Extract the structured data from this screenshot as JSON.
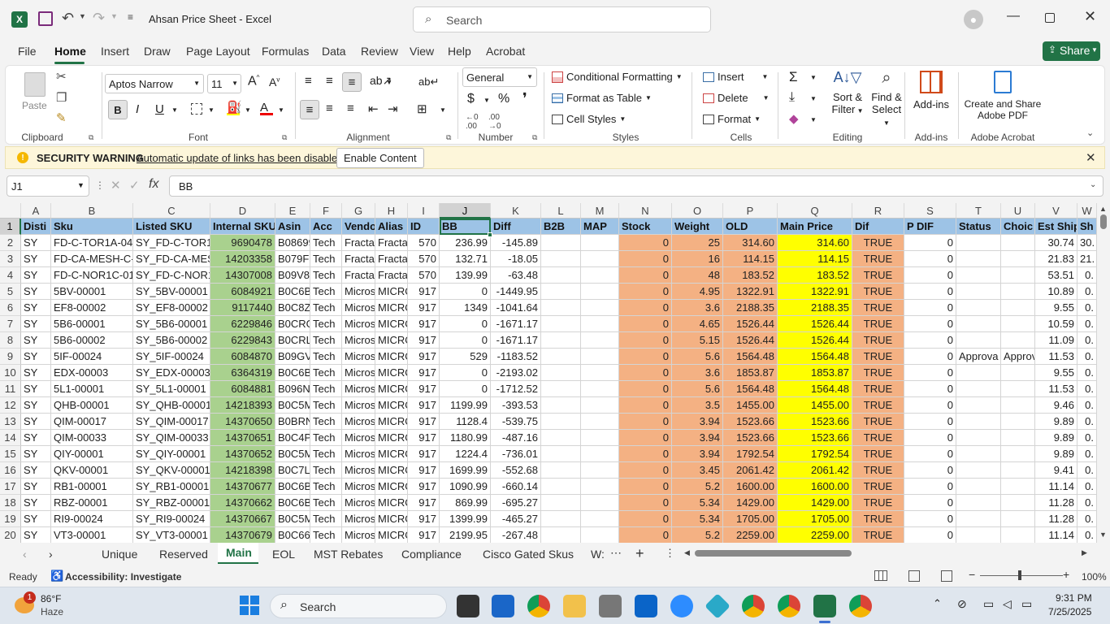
{
  "title": {
    "filename": "Ahsan Price Sheet",
    "app": "Excel",
    "separator": " - ",
    "search_placeholder": "Search"
  },
  "menu": [
    "File",
    "Home",
    "Insert",
    "Draw",
    "Page Layout",
    "Formulas",
    "Data",
    "Review",
    "View",
    "Help",
    "Acrobat"
  ],
  "share_label": "Share",
  "ribbon": {
    "paste": "Paste",
    "clipboard": "Clipboard",
    "font_name": "Aptos Narrow",
    "font_size": "11",
    "font": "Font",
    "alignment": "Alignment",
    "number_format": "General",
    "number": "Number",
    "conditional_formatting": "Conditional Formatting",
    "format_as_table": "Format as Table",
    "cell_styles": "Cell Styles",
    "styles": "Styles",
    "insert": "Insert",
    "delete": "Delete",
    "format": "Format",
    "cells": "Cells",
    "sort_filter_1": "Sort &",
    "sort_filter_2": "Filter",
    "find_select_1": "Find &",
    "find_select_2": "Select",
    "editing": "Editing",
    "addins": "Add-ins",
    "addins_group": "Add-ins",
    "create_share_1": "Create and Share",
    "create_share_2": "Adobe PDF",
    "adobe_acrobat": "Adobe Acrobat"
  },
  "security": {
    "label": "SECURITY WARNING",
    "message": "Automatic update of links has been disabled",
    "button": "Enable Content"
  },
  "formula": {
    "namebox": "J1",
    "content": "BB"
  },
  "columns": [
    "A",
    "B",
    "C",
    "D",
    "E",
    "F",
    "G",
    "H",
    "I",
    "J",
    "K",
    "L",
    "M",
    "N",
    "O",
    "P",
    "Q",
    "R",
    "S",
    "T",
    "U",
    "V",
    "W"
  ],
  "headers": [
    "Disti",
    "Sku",
    "Listed SKU",
    "Internal SKU",
    "Asin",
    "Acc",
    "Vendo",
    "Alias",
    "ID",
    "BB",
    "Diff",
    "B2B",
    "MAP",
    "Stock",
    "Weight",
    "OLD",
    "Main Price",
    "Dif",
    "P DIF",
    "Status",
    "Choic",
    "Est Ship",
    "Sh"
  ],
  "rows": [
    {
      "n": "2",
      "c": [
        "SY",
        "FD-C-TOR1A-04",
        "SY_FD-C-TOR1A",
        "9690478",
        "B08699",
        "Tech",
        "Fracta",
        "Fracta",
        "570",
        "236.99",
        "-145.89",
        "",
        "",
        "0",
        "25",
        "314.60",
        "314.60",
        "TRUE",
        "0",
        "",
        "",
        "30.74",
        "30."
      ]
    },
    {
      "n": "3",
      "c": [
        "SY",
        "FD-CA-MESH-C-B",
        "SY_FD-CA-MESH",
        "14203358",
        "B079FF",
        "Tech",
        "Fracta",
        "Fracta",
        "570",
        "132.71",
        "-18.05",
        "",
        "",
        "0",
        "16",
        "114.15",
        "114.15",
        "TRUE",
        "0",
        "",
        "",
        "21.83",
        "21."
      ]
    },
    {
      "n": "4",
      "c": [
        "SY",
        "FD-C-NOR1C-01",
        "SY_FD-C-NOR1C",
        "14307008",
        "B09V87",
        "Tech",
        "Fracta",
        "Fracta",
        "570",
        "139.99",
        "-63.48",
        "",
        "",
        "0",
        "48",
        "183.52",
        "183.52",
        "TRUE",
        "0",
        "",
        "",
        "53.51",
        "0."
      ]
    },
    {
      "n": "5",
      "c": [
        "SY",
        "5BV-00001",
        "SY_5BV-00001",
        "6084921",
        "B0C6B8",
        "Tech",
        "Micros",
        "MICRO",
        "917",
        "0",
        "-1449.95",
        "",
        "",
        "0",
        "4.95",
        "1322.91",
        "1322.91",
        "TRUE",
        "0",
        "",
        "",
        "10.89",
        "0."
      ]
    },
    {
      "n": "6",
      "c": [
        "SY",
        "EF8-00002",
        "SY_EF8-00002",
        "9117440",
        "B0C8Z0",
        "Tech",
        "Micros",
        "MICRO",
        "917",
        "1349",
        "-1041.64",
        "",
        "",
        "0",
        "3.6",
        "2188.35",
        "2188.35",
        "TRUE",
        "0",
        "",
        "",
        "9.55",
        "0."
      ]
    },
    {
      "n": "7",
      "c": [
        "SY",
        "5B6-00001",
        "SY_5B6-00001",
        "6229846",
        "B0CRGI",
        "Tech",
        "Micros",
        "MICRO",
        "917",
        "0",
        "-1671.17",
        "",
        "",
        "0",
        "4.65",
        "1526.44",
        "1526.44",
        "TRUE",
        "0",
        "",
        "",
        "10.59",
        "0."
      ]
    },
    {
      "n": "8",
      "c": [
        "SY",
        "5B6-00002",
        "SY_5B6-00002",
        "6229843",
        "B0CRLS",
        "Tech",
        "Micros",
        "MICRO",
        "917",
        "0",
        "-1671.17",
        "",
        "",
        "0",
        "5.15",
        "1526.44",
        "1526.44",
        "TRUE",
        "0",
        "",
        "",
        "11.09",
        "0."
      ]
    },
    {
      "n": "9",
      "c": [
        "SY",
        "5IF-00024",
        "SY_5IF-00024",
        "6084870",
        "B09GVS",
        "Tech",
        "Micros",
        "MICRO",
        "917",
        "529",
        "-1183.52",
        "",
        "",
        "0",
        "5.6",
        "1564.48",
        "1564.48",
        "TRUE",
        "0",
        "Approva",
        "Approv",
        "11.53",
        "0."
      ]
    },
    {
      "n": "10",
      "c": [
        "SY",
        "EDX-00003",
        "SY_EDX-00003",
        "6364319",
        "B0C6BI",
        "Tech",
        "Micros",
        "MICRO",
        "917",
        "0",
        "-2193.02",
        "",
        "",
        "0",
        "3.6",
        "1853.87",
        "1853.87",
        "TRUE",
        "0",
        "",
        "",
        "9.55",
        "0."
      ]
    },
    {
      "n": "11",
      "c": [
        "SY",
        "5L1-00001",
        "SY_5L1-00001",
        "6084881",
        "B096N",
        "Tech",
        "Micros",
        "MICRO",
        "917",
        "0",
        "-1712.52",
        "",
        "",
        "0",
        "5.6",
        "1564.48",
        "1564.48",
        "TRUE",
        "0",
        "",
        "",
        "11.53",
        "0."
      ]
    },
    {
      "n": "12",
      "c": [
        "SY",
        "QHB-00001",
        "SY_QHB-00001",
        "14218393",
        "B0C5M",
        "Tech",
        "Micros",
        "MICRO",
        "917",
        "1199.99",
        "-393.53",
        "",
        "",
        "0",
        "3.5",
        "1455.00",
        "1455.00",
        "TRUE",
        "0",
        "",
        "",
        "9.46",
        "0."
      ]
    },
    {
      "n": "13",
      "c": [
        "SY",
        "QIM-00017",
        "SY_QIM-00017",
        "14370650",
        "B0BRN",
        "Tech",
        "Micros",
        "MICRO",
        "917",
        "1128.4",
        "-539.75",
        "",
        "",
        "0",
        "3.94",
        "1523.66",
        "1523.66",
        "TRUE",
        "0",
        "",
        "",
        "9.89",
        "0."
      ]
    },
    {
      "n": "14",
      "c": [
        "SY",
        "QIM-00033",
        "SY_QIM-00033",
        "14370651",
        "B0C4P",
        "Tech",
        "Micros",
        "MICRO",
        "917",
        "1180.99",
        "-487.16",
        "",
        "",
        "0",
        "3.94",
        "1523.66",
        "1523.66",
        "TRUE",
        "0",
        "",
        "",
        "9.89",
        "0."
      ]
    },
    {
      "n": "15",
      "c": [
        "SY",
        "QIY-00001",
        "SY_QIY-00001",
        "14370652",
        "B0C5M",
        "Tech",
        "Micros",
        "MICRO",
        "917",
        "1224.4",
        "-736.01",
        "",
        "",
        "0",
        "3.94",
        "1792.54",
        "1792.54",
        "TRUE",
        "0",
        "",
        "",
        "9.89",
        "0."
      ]
    },
    {
      "n": "16",
      "c": [
        "SY",
        "QKV-00001",
        "SY_QKV-00001",
        "14218398",
        "B0C7LH",
        "Tech",
        "Micros",
        "MICRO",
        "917",
        "1699.99",
        "-552.68",
        "",
        "",
        "0",
        "3.45",
        "2061.42",
        "2061.42",
        "TRUE",
        "0",
        "",
        "",
        "9.41",
        "0."
      ]
    },
    {
      "n": "17",
      "c": [
        "SY",
        "RB1-00001",
        "SY_RB1-00001",
        "14370677",
        "B0C6B3",
        "Tech",
        "Micros",
        "MICRO",
        "917",
        "1090.99",
        "-660.14",
        "",
        "",
        "0",
        "5.2",
        "1600.00",
        "1600.00",
        "TRUE",
        "0",
        "",
        "",
        "11.14",
        "0."
      ]
    },
    {
      "n": "18",
      "c": [
        "SY",
        "RBZ-00001",
        "SY_RBZ-00001",
        "14370662",
        "B0C6B8",
        "Tech",
        "Micros",
        "MICRO",
        "917",
        "869.99",
        "-695.27",
        "",
        "",
        "0",
        "5.34",
        "1429.00",
        "1429.00",
        "TRUE",
        "0",
        "",
        "",
        "11.28",
        "0."
      ]
    },
    {
      "n": "19",
      "c": [
        "SY",
        "RI9-00024",
        "SY_RI9-00024",
        "14370667",
        "B0C5M",
        "Tech",
        "Micros",
        "MICRO",
        "917",
        "1399.99",
        "-465.27",
        "",
        "",
        "0",
        "5.34",
        "1705.00",
        "1705.00",
        "TRUE",
        "0",
        "",
        "",
        "11.28",
        "0."
      ]
    },
    {
      "n": "20",
      "c": [
        "SY",
        "VT3-00001",
        "SY_VT3-00001",
        "14370679",
        "B0C661",
        "Tech",
        "Micros",
        "MICRO",
        "917",
        "2199.95",
        "-267.48",
        "",
        "",
        "0",
        "5.2",
        "2259.00",
        "2259.00",
        "TRUE",
        "0",
        "",
        "",
        "11.14",
        "0."
      ]
    }
  ],
  "sheets": [
    "Unique",
    "Reserved",
    "Main",
    "EOL",
    "MST Rebates",
    "Compliance",
    "Cisco Gated Skus",
    "W:"
  ],
  "active_sheet": "Main",
  "status": {
    "ready": "Ready",
    "accessibility": "Accessibility: Investigate",
    "zoom": "100%"
  },
  "taskbar": {
    "temp": "86°F",
    "weather": "Haze",
    "search": "Search",
    "time": "9:31 PM",
    "date": "7/25/2025",
    "badge": "1"
  },
  "colors": {
    "excel_green": "#217346",
    "header_blue": "#9dc3e6",
    "internal_green": "#a9d18e",
    "salmon": "#f4b183",
    "yellow": "#ffff00"
  }
}
